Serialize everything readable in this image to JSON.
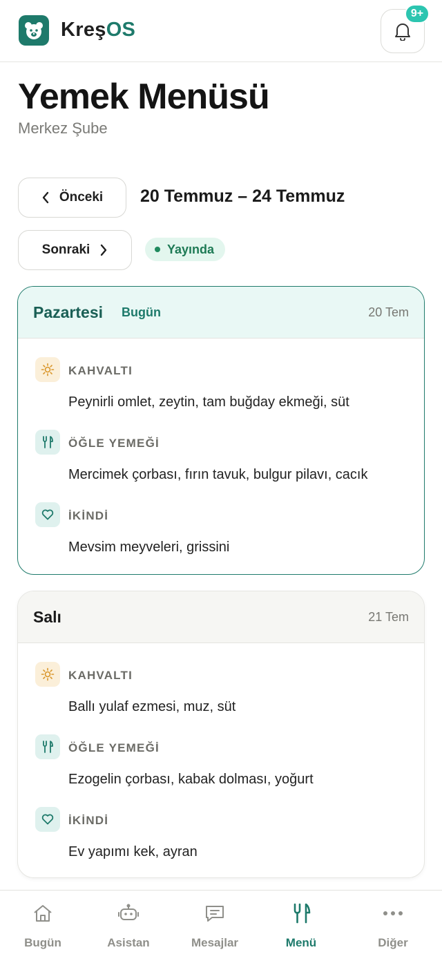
{
  "header": {
    "brand_main": "Kreş",
    "brand_accent": "OS",
    "notification_badge": "9+"
  },
  "page": {
    "title": "Yemek Menüsü",
    "subtitle": "Merkez Şube"
  },
  "week_nav": {
    "prev_label": "Önceki",
    "next_label": "Sonraki",
    "range": "20 Temmuz – 24 Temmuz",
    "status": "Yayında"
  },
  "days": [
    {
      "name": "Pazartesi",
      "today_label": "Bugün",
      "date": "20 Tem",
      "meals": [
        {
          "label": "KAHVALTI",
          "text": "Peynirli omlet, zeytin, tam buğday ekmeği, süt",
          "icon": "sun-icon"
        },
        {
          "label": "ÖĞLE YEMEĞİ",
          "text": "Mercimek çorbası, fırın tavuk, bulgur pilavı, cacık",
          "icon": "fork-knife-icon"
        },
        {
          "label": "İKİNDİ",
          "text": "Mevsim meyveleri, grissini",
          "icon": "heart-icon"
        }
      ]
    },
    {
      "name": "Salı",
      "date": "21 Tem",
      "meals": [
        {
          "label": "KAHVALTI",
          "text": "Ballı yulaf ezmesi, muz, süt",
          "icon": "sun-icon"
        },
        {
          "label": "ÖĞLE YEMEĞİ",
          "text": "Ezogelin çorbası, kabak dolması, yoğurt",
          "icon": "fork-knife-icon"
        },
        {
          "label": "İKİNDİ",
          "text": "Ev yapımı kek, ayran",
          "icon": "heart-icon"
        }
      ]
    }
  ],
  "bottom_nav": [
    {
      "label": "Bugün",
      "icon": "home-icon"
    },
    {
      "label": "Asistan",
      "icon": "robot-icon"
    },
    {
      "label": "Mesajlar",
      "icon": "message-icon"
    },
    {
      "label": "Menü",
      "icon": "fork-knife-icon",
      "active": true
    },
    {
      "label": "Diğer",
      "icon": "more-icon"
    }
  ],
  "colors": {
    "brand": "#1e7a6b",
    "badge": "#2cc5b0",
    "status_bg": "#e3f6ee",
    "status_text": "#1e7a55"
  }
}
